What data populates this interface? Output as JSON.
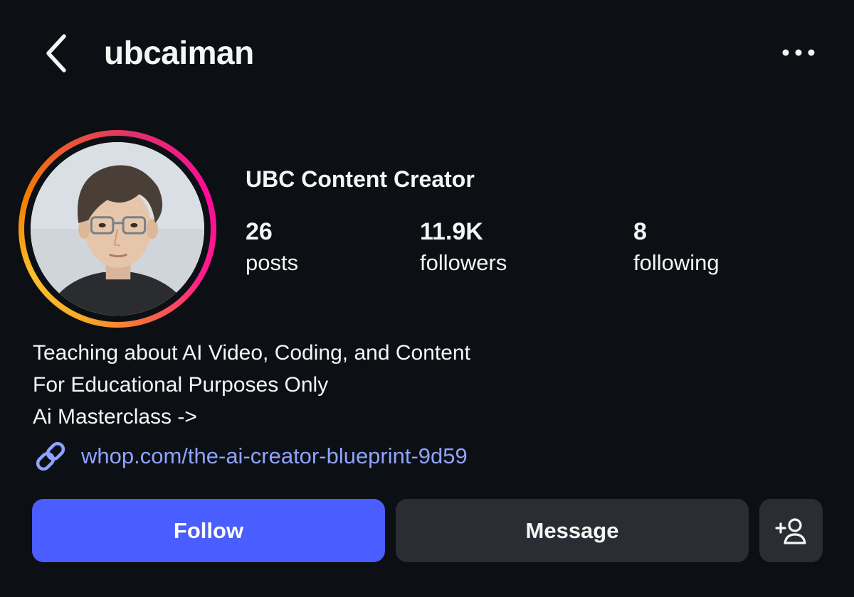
{
  "header": {
    "username": "ubcaiman"
  },
  "profile": {
    "display_name": "UBC Content Creator",
    "stats": [
      {
        "value": "26",
        "label": "posts"
      },
      {
        "value": "11.9K",
        "label": "followers"
      },
      {
        "value": "8",
        "label": "following"
      }
    ],
    "bio": [
      "Teaching about AI Video, Coding, and Content",
      "For Educational Purposes Only",
      "Ai Masterclass ->"
    ],
    "link": "whop.com/the-ai-creator-blueprint-9d59"
  },
  "actions": {
    "follow_label": "Follow",
    "message_label": "Message"
  },
  "icons": {
    "back": "chevron-left-icon",
    "more": "more-horizontal-icon",
    "link": "link-icon",
    "add_person": "add-person-icon"
  },
  "colors": {
    "background": "#0c1014",
    "follow_button": "#4a5dff",
    "secondary_button": "#2a2e34",
    "link_text": "#8ea3ff"
  }
}
